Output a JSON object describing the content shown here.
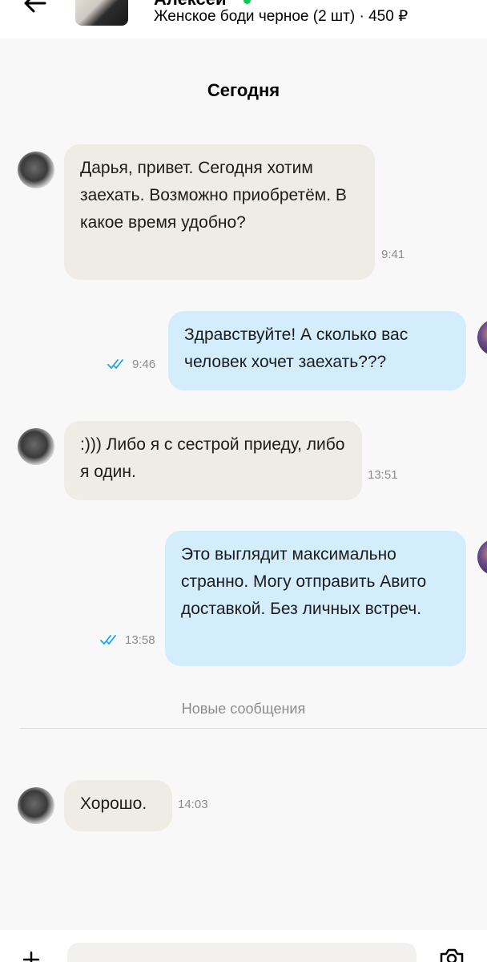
{
  "header": {
    "contact_name": "Алексей",
    "product_line": "Женское боди черное (2 шт) · 450 ₽",
    "back_icon": "arrow-left-icon",
    "online_color": "#15c45b"
  },
  "chat": {
    "day_label": "Сегодня",
    "new_messages_label": "Новые сообщения",
    "messages": [
      {
        "direction": "in",
        "text": "Дарья, привет. Сегодня хотим заехать. Возможно приобретём. В какое время удобно?",
        "time": "9:41"
      },
      {
        "direction": "out",
        "text": "Здравствуйте! А сколько вас человек хочет заехать???",
        "time": "9:46",
        "status": "read"
      },
      {
        "direction": "in",
        "text": ":))) Либо я с сестрой приеду, либо я один.",
        "time": "13:51"
      },
      {
        "direction": "out",
        "text": "Это выглядит максимально странно. Могу отправить Авито доставкой. Без личных встреч.",
        "time": "13:58",
        "status": "read"
      },
      {
        "direction": "in",
        "text": "Хорошо.",
        "time": "14:03"
      }
    ]
  },
  "composer": {
    "placeholder": "",
    "attach_icon": "plus-icon",
    "camera_icon": "camera-icon"
  },
  "colors": {
    "incoming_bubble": "#efece6",
    "outgoing_bubble": "#d3edfc",
    "read_check": "#1aa3f0"
  }
}
